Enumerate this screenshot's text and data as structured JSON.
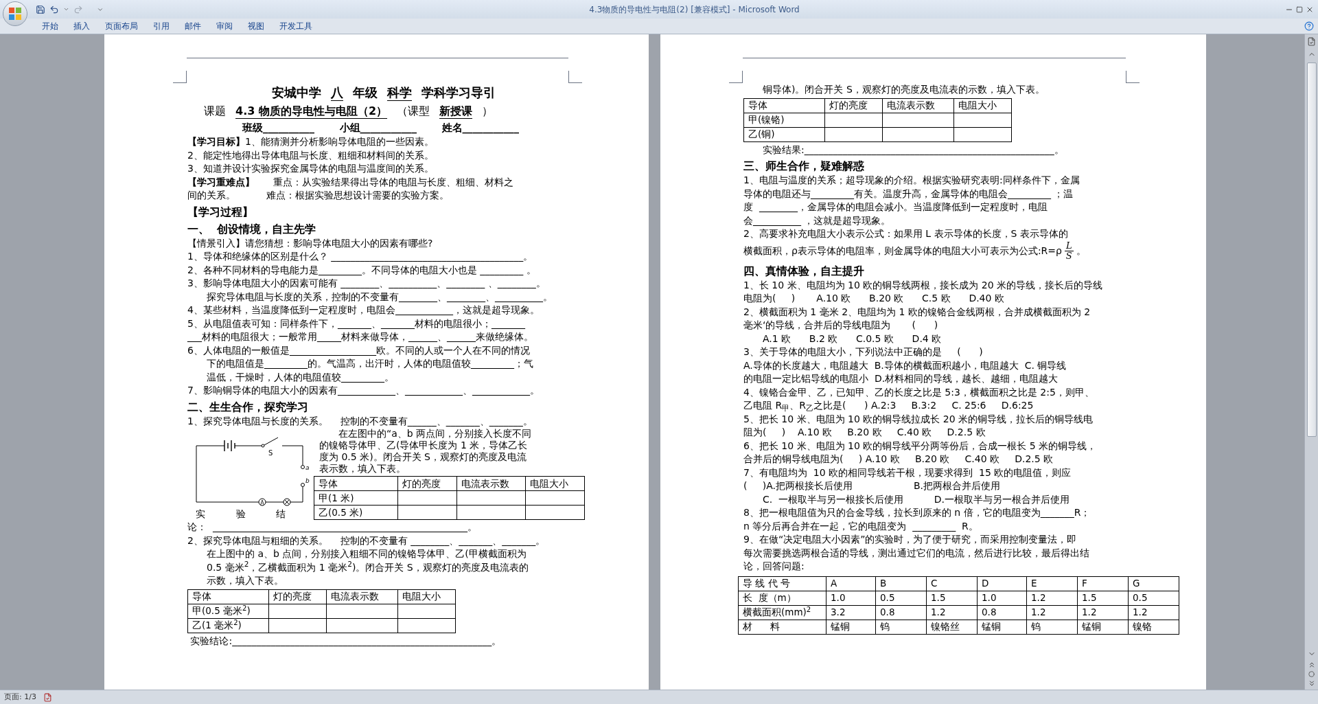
{
  "window": {
    "title": "4.3物质的导电性与电阻(2) [兼容模式] - Microsoft Word"
  },
  "ribbon_tabs": [
    "开始",
    "插入",
    "页面布局",
    "引用",
    "邮件",
    "审阅",
    "视图",
    "开发工具"
  ],
  "pages": [
    {
      "blocks": [
        {
          "kind": "title",
          "segments": [
            {
              "text": "安城中学",
              "underline": false,
              "bold": true
            },
            {
              "text": "八",
              "underline": true,
              "bold": true
            },
            {
              "text": "年级",
              "underline": false,
              "bold": true
            },
            {
              "text": "科学",
              "underline": true,
              "bold": true
            },
            {
              "text": "学科学习导引",
              "underline": false,
              "bold": true
            }
          ]
        },
        {
          "kind": "topic",
          "segments": [
            {
              "text": "课题",
              "underline": false,
              "bold": false
            },
            {
              "text": "4.3 物质的导电性与电阻（2）",
              "underline": true,
              "bold": true
            },
            {
              "text": "（课型",
              "underline": false,
              "bold": false
            },
            {
              "text": "新授课",
              "underline": true,
              "bold": true
            },
            {
              "text": "）",
              "underline": false,
              "bold": false
            }
          ]
        },
        {
          "kind": "fields",
          "text": "班级__________       小组___________       姓名___________"
        },
        {
          "kind": "line",
          "text": "**【学习目标】**1、能猜测并分析影响导体电阻的一些因素。"
        },
        {
          "kind": "line",
          "text": "2、能定性地得出导体电阻与长度、粗细和材料间的关系。"
        },
        {
          "kind": "line",
          "text": "3、知道并设计实验探究金属导体的电阻与温度间的关系。"
        },
        {
          "kind": "line",
          "text": "**【学习重难点】**      重点：从实验结果得出导体的电阻与长度、粗细、材料之"
        },
        {
          "kind": "line",
          "text": "间的关系。          难点：根据实验思想设计需要的实验方案。"
        },
        {
          "kind": "heading",
          "text": "【学习过程】"
        },
        {
          "kind": "heading",
          "text": "一、  创设情境，自主先学"
        },
        {
          "kind": "line",
          "text": "【情景引入】请您猜想：影响导体电阻大小的因素有哪些?"
        },
        {
          "kind": "line",
          "text": "1、导体和绝缘体的区别是什么？ ________________________________________。"
        },
        {
          "kind": "line",
          "text": "2、各种不同材料的导电能力是_________。不同导体的电阻大小也是 _________ 。"
        },
        {
          "kind": "line",
          "text": "3、影响导体电阻大小的因素可能有 ________、__________、________ 、________。"
        },
        {
          "kind": "indent",
          "text": "探究导体电阻与长度的关系，控制的不变量有________、________、__________。"
        },
        {
          "kind": "line",
          "text": "4、某些材料，当温度降低到一定程度时，电阻会____________，这就是超导现象。"
        },
        {
          "kind": "line",
          "text": "5、从电阻值表可知：同样条件下，_______、_______材料的电阻很小；_______"
        },
        {
          "kind": "line",
          "text": "___材料的电阻很大；一般常用_____材料来做导体，______、______来做绝缘体。"
        },
        {
          "kind": "line",
          "text": "6、人体电阻的一般值是__________________欧。不同的人或一个人在不同的情况"
        },
        {
          "kind": "indent",
          "text": "下的电阻值是_________的。气温高，出汗时，人体的电阻值较_________；气"
        },
        {
          "kind": "indent",
          "text": "温低，干燥时，人体的电阻值较_________。"
        },
        {
          "kind": "line",
          "text": "7、影响铜导体的电阻大小的因素有____________、____________、____________。"
        },
        {
          "kind": "heading",
          "text": "二、生生合作，探究学习"
        },
        {
          "kind": "line",
          "text": "1、探究导体电阻与长度的关系。    控制的不变量有______、_______、_______。"
        },
        {
          "kind": "figure",
          "labels": {
            "switch": "S",
            "a": "a",
            "b": "b",
            "ammeter": "A"
          },
          "lines": [
            "在左图中的“a、b 两点间，分别接入长度不同",
            "的镍铬导体甲、乙(导体甲长度为 1 米，导体乙长",
            "度为 0.5 米)。闭合开关 S，观察灯的亮度及电流",
            "表示数，填入下表。"
          ],
          "table": {
            "columns": [
              "导体",
              "灯的亮度",
              "电流表示数",
              "电阻大小"
            ],
            "rows": [
              [
                "甲(1 米)"
              ],
              [
                "乙(0.5 米)"
              ]
            ]
          },
          "caption": "实          验          结"
        },
        {
          "kind": "line",
          "text": "论：  _____________________________________________________。"
        },
        {
          "kind": "line",
          "text": "2、探究导体电阻与粗细的关系。    控制的不变量有 ________、_______、_______。"
        },
        {
          "kind": "indent",
          "text": "在上图中的 a、b 点间，分别接入粗细不同的镍铬导体甲、乙(甲横截面积为"
        },
        {
          "kind": "indent",
          "text": "0.5 毫米$^{2}$，乙横截面积为 1 毫米$^{2}$)。闭合开关 S，观察灯的亮度及电流表的"
        },
        {
          "kind": "indent",
          "text": "示数，填入下表。"
        },
        {
          "kind": "table",
          "columns": [
            "导体",
            "灯的亮度",
            "电流表示数",
            "电阻大小"
          ],
          "rows": [
            [
              "甲(0.5 毫米$^{2}$)"
            ],
            [
              "乙(1 毫米$^{2}$)"
            ]
          ]
        },
        {
          "kind": "line",
          "text": " 实验结论:______________________________________________________。"
        }
      ]
    },
    {
      "blocks": [
        {
          "kind": "indent",
          "text": "铜导体)。闭合开关 S，观察灯的亮度及电流表的示数，填入下表。"
        },
        {
          "kind": "table",
          "columns": [
            "导体",
            "灯的亮度",
            "电流表示数",
            "电阻大小"
          ],
          "rows": [
            [
              "甲(镍铬)"
            ],
            [
              "乙(铜)"
            ]
          ]
        },
        {
          "kind": "indent",
          "text": "实验结果:____________________________________________________。"
        },
        {
          "kind": "heading",
          "text": "三、师生合作，疑难解惑"
        },
        {
          "kind": "line",
          "text": "1、电阻与温度的关系；超导现象的介绍。根据实验研究表明:同样条件下，金属"
        },
        {
          "kind": "line",
          "text": "导体的电阻还与_________有关。温度升高，金属导体的电阻会_________ ；温"
        },
        {
          "kind": "line",
          "text": "度  ________，金属导体的电阻会减小。当温度降低到一定程度时，电阻"
        },
        {
          "kind": "line",
          "text": "会__________ ，这就是超导现象。"
        },
        {
          "kind": "line",
          "text": "2、高要求补充电阻大小表示公式：如果用 L 表示导体的长度，S 表示导体的"
        },
        {
          "kind": "formula",
          "text": "横截面积，ρ表示导体的电阻率，则金属导体的电阻大小可表示为公式:R=ρ",
          "numerator": "L",
          "denominator": "S",
          "end": "。"
        },
        {
          "kind": "heading",
          "text": "四、真情体验，自主提升"
        },
        {
          "kind": "line",
          "text": "1、长 10 米、电阻均为 10 欧的铜导线两根，接长成为 20 米的导线，接长后的导线"
        },
        {
          "kind": "line",
          "text": "电阻为(     )       A.10 欧      B.20 欧      C.5 欧      D.40 欧"
        },
        {
          "kind": "line",
          "text": "2、横截面积为 1 毫米 2、电阻均为 1 欧的镍铬合金线两根，合并成横截面积为 2"
        },
        {
          "kind": "line",
          "text": "毫米‘的导线，合并后的导线电阻为       (      )"
        },
        {
          "kind": "indent",
          "text": "A.1 欧      B.2 欧      C.0.5 欧      D.4 欧"
        },
        {
          "kind": "line",
          "text": "3、关于导体的电阻大小，下列说法中正确的是     (      )"
        },
        {
          "kind": "line",
          "text": "A.导体的长度越大，电阻越大  B.导体的横截面积越小，电阻越大  C. 铜导线"
        },
        {
          "kind": "line",
          "text": "的电阻一定比铝导线的电阻小  D.材料相同的导线，越长、越细，电阻越大"
        },
        {
          "kind": "line",
          "text": "4、镍铬合金甲、乙，已知甲、乙的长度之比是 5:3，横截面积之比是 2:5，则甲、"
        },
        {
          "kind": "line",
          "text": "乙电阻 R$_{甲}$、R$_{乙}$之比是(      ) A.2:3     B.3:2     C. 25:6     D.6:25"
        },
        {
          "kind": "line",
          "text": "5、把长 10 米、电阻为 10 欧的铜导线拉成长 20 米的铜导线，拉长后的铜导线电"
        },
        {
          "kind": "line",
          "text": "阻为(     )    A.10 欧     B.20 欧     C.40 欧     D.2.5 欧"
        },
        {
          "kind": "line",
          "text": "6、把长 10 米、电阻为 10 欧的铜导线平分两等份后，合成一根长 5 米的铜导线，"
        },
        {
          "kind": "line",
          "text": "合并后的铜导线电阻为(     ) A.10 欧     B.20 欧     C.40 欧     D.2.5 欧"
        },
        {
          "kind": "line",
          "text": "7、有电阻均为  10 欧的相同导线若干根，现要求得到  15 欧的电阻值，则应"
        },
        {
          "kind": "line",
          "text": "(     )A.把两根接长后使用                    B.把两根合并后使用"
        },
        {
          "kind": "indent",
          "text": "C.  一根取半与另一根接长后使用          D.一根取半与另一根合并后使用"
        },
        {
          "kind": "line",
          "text": "8、把一根电阻值为只的合金导线，拉长到原来的 n 倍，它的电阻变为_______R；"
        },
        {
          "kind": "line",
          "text": "n 等分后再合并在一起，它的电阻变为  _________  R。"
        },
        {
          "kind": "line",
          "text": "9、在做“决定电阻大小因素”的实验时，为了便于研究，而采用控制变量法，即"
        },
        {
          "kind": "line",
          "text": "每次需要挑选两根合适的导线，测出通过它们的电流，然后进行比较，最后得出结"
        },
        {
          "kind": "line",
          "text": "论，回答问题:"
        },
        {
          "kind": "grid",
          "rows": [
            [
              "导 线 代 号",
              "A",
              "B",
              "C",
              "D",
              "E",
              "F",
              "G"
            ],
            [
              "长  度（m）",
              "1.0",
              "0.5",
              "1.5",
              "1.0",
              "1.2",
              "1.5",
              "0.5"
            ],
            [
              "横截面积(mm)$^{2}$",
              "3.2",
              "0.8",
              "1.2",
              "0.8",
              "1.2",
              "1.2",
              "1.2"
            ],
            [
              "材      料",
              "锰铜",
              "钨",
              "镍铬丝",
              "锰铜",
              "钨",
              "锰铜",
              "镍铬"
            ]
          ]
        }
      ]
    }
  ],
  "status_bar": {
    "page": "页面: 1/3"
  }
}
